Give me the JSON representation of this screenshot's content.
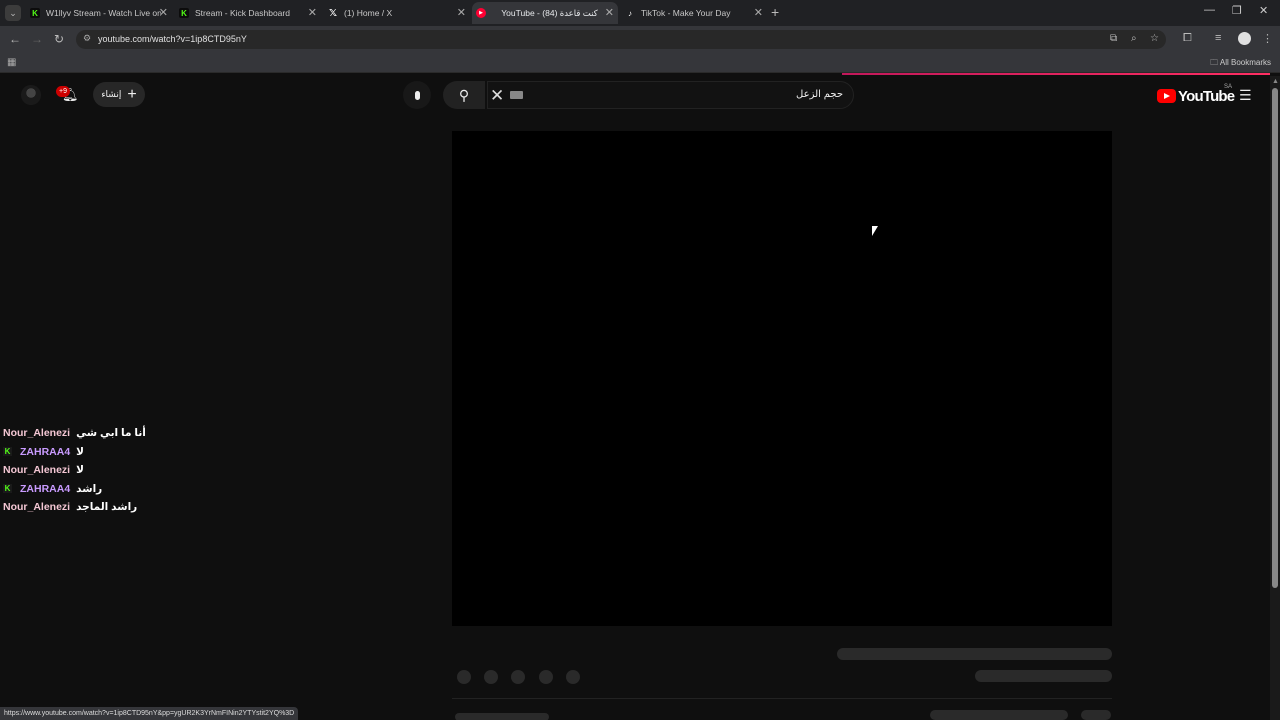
{
  "browser": {
    "tabs": [
      {
        "title": "W1llyv Stream - Watch Live on ",
        "icon": "kick-icon"
      },
      {
        "title": "Stream - Kick Dashboard",
        "icon": "kick-icon"
      },
      {
        "title": "(1) Home / X",
        "icon": "x-icon"
      },
      {
        "title": "YouTube - ‏كنت قاعدة‏ (84)",
        "icon": "youtube-icon",
        "active": true
      },
      {
        "title": "TikTok - Make Your Day",
        "icon": "tiktok-icon"
      }
    ],
    "url": "youtube.com/watch?v=1ip8CTD95nY",
    "bookmarks_label": "All Bookmarks",
    "status_url": "https://www.youtube.com/watch?v=1ip8CTD95nY&pp=ygUR2K3YrNmFINin2YTYstit2YQ%3D"
  },
  "youtube": {
    "logo_text": "YouTube",
    "region": "SA",
    "search_query": "حجم الزعل",
    "create_label": "إنشاء",
    "notification_count": "+9"
  },
  "chat": [
    {
      "user": "Nour_Alenezi",
      "message": "أنا ما ابي شي",
      "color": "#f4c7d4",
      "kick": false
    },
    {
      "user": "ZAHRAA4",
      "message": "لا",
      "color": "#c99bff",
      "kick": true
    },
    {
      "user": "Nour_Alenezi",
      "message": "لا",
      "color": "#f4c7d4",
      "kick": false
    },
    {
      "user": "ZAHRAA4",
      "message": "راشد",
      "color": "#c99bff",
      "kick": true
    },
    {
      "user": "Nour_Alenezi",
      "message": "راشد الماجد",
      "color": "#f4c7d4",
      "kick": false
    }
  ],
  "colors": {
    "accent": "#ff0000",
    "kick": "#53fc18",
    "background": "#0f0f0f"
  }
}
